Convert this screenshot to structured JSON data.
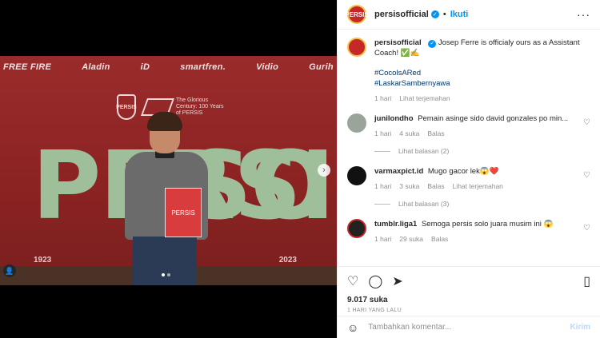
{
  "media": {
    "sponsors": [
      "FREE FIRE",
      "Aladin",
      "iD",
      "smartfren.",
      "Vidio",
      "Gurih"
    ],
    "crest_text": "PERSIS",
    "century_text": "The Glorious Century: 100 Years of PERSIS",
    "big_left": "PERSIS",
    "big_right": "SOLO",
    "year_left": "1923",
    "year_right": "2023",
    "folder_text": "PERSIS",
    "next_icon": "chevron-right-icon",
    "tag_icon": "user-icon"
  },
  "header": {
    "username": "persisofficial",
    "separator": "•",
    "follow": "Ikuti",
    "more": "···",
    "avatar_text": "PERSIS"
  },
  "caption": {
    "username": "persisofficial",
    "text": "Josep Ferre is officialy ours as a Assistant Coach! ✅✍️",
    "hashtags": [
      "#CocolsARed",
      "#LaskarSambernyawa"
    ],
    "time": "1 hari",
    "translate": "Lihat terjemahan"
  },
  "comments": [
    {
      "username": "junilondho",
      "text": "Pemain asinge sido david gonzales po min...",
      "time": "1 hari",
      "likes": "4 suka",
      "reply": "Balas",
      "translate": "",
      "replies": "Lihat balasan (2)",
      "avatar_color": "#9aa49a"
    },
    {
      "username": "varmaxpict.id",
      "text": "Mugo gacor lek😱❤️",
      "time": "1 hari",
      "likes": "3 suka",
      "reply": "Balas",
      "translate": "Lihat terjemahan",
      "replies": "Lihat balasan (3)",
      "avatar_color": "#111111"
    },
    {
      "username": "tumblr.liga1",
      "text": "Semoga persis solo juara musim ini 😱",
      "time": "1 hari",
      "likes": "29 suka",
      "reply": "Balas",
      "translate": "",
      "replies": "",
      "avatar_color": "#222222"
    }
  ],
  "actions": {
    "like_icon": "heart-icon",
    "comment_icon": "comment-icon",
    "share_icon": "send-icon",
    "save_icon": "bookmark-icon",
    "likes": "9.017 suka",
    "time": "1 HARI YANG LALU"
  },
  "add_comment": {
    "emoji_icon": "emoji-icon",
    "placeholder": "Tambahkan komentar...",
    "post": "Kirim"
  },
  "colors": {
    "accent": "#0095f6",
    "brand": "#c62828"
  }
}
